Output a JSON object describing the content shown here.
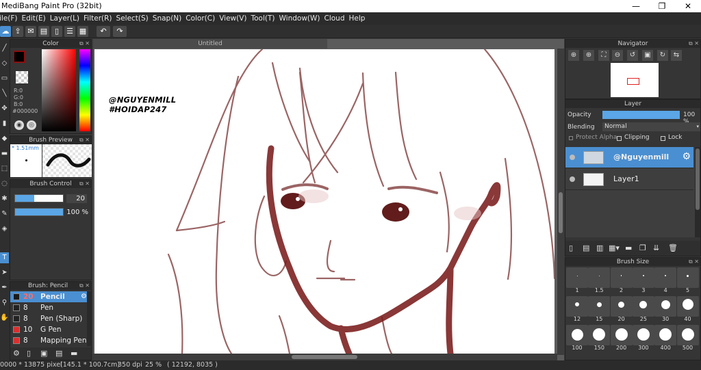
{
  "titlebar": {
    "title": "MediBang Paint Pro (32bit)",
    "minimize": "—",
    "maximize": "❐",
    "close": "✕"
  },
  "menu": [
    "ile(F)",
    "Edit(E)",
    "Layer(L)",
    "Filter(R)",
    "Select(S)",
    "Snap(N)",
    "Color(C)",
    "View(V)",
    "Tool(T)",
    "Window(W)",
    "Cloud",
    "Help"
  ],
  "document": {
    "tab": "Untitled",
    "watermark_line1": "@NGUYENMILL",
    "watermark_line2": "#HOIDAP247"
  },
  "color_panel": {
    "title": "Color",
    "r": "R:0",
    "g": "G:0",
    "b": "B:0",
    "hex": "#000000",
    "foreground": "#8b0f0f"
  },
  "brush_preview": {
    "title": "Brush Preview",
    "size": "* 1.51mm"
  },
  "brush_control": {
    "title": "Brush Control",
    "size_value": "20",
    "opacity_value": "100 %"
  },
  "brush_list": {
    "title": "Brush: Pencil",
    "items": [
      {
        "size": "20",
        "name": "Pencil",
        "color": "#1a1a1a",
        "selected": true
      },
      {
        "size": "8",
        "name": "Pen",
        "color": "#222222",
        "selected": false
      },
      {
        "size": "8",
        "name": "Pen (Sharp)",
        "color": "#222222",
        "selected": false
      },
      {
        "size": "10",
        "name": "G Pen",
        "color": "#d93030",
        "selected": false
      },
      {
        "size": "8",
        "name": "Mapping Pen",
        "color": "#d93030",
        "selected": false
      }
    ]
  },
  "navigator": {
    "title": "Navigator"
  },
  "layer_panel": {
    "title": "Layer",
    "opacity_label": "Opacity",
    "opacity_value": "100 %",
    "opacity_fraction": 1.0,
    "blending_label": "Blending",
    "blending_value": "Normal",
    "protect_alpha": "Protect Alpha",
    "clipping": "Clipping",
    "lock": "Lock",
    "layers": [
      {
        "name": "@Nguyenmill",
        "selected": true
      },
      {
        "name": "Layer1",
        "selected": false
      }
    ]
  },
  "brush_size": {
    "title": "Brush Size",
    "rows": [
      [
        "1",
        "1.5",
        "2",
        "3",
        "4",
        "5"
      ],
      [
        "12",
        "15",
        "20",
        "25",
        "30",
        "40"
      ],
      [
        "100",
        "150",
        "200",
        "300",
        "400",
        "500"
      ]
    ]
  },
  "status": {
    "dimensions": "0000 * 13875 pixel",
    "size_cm": "(145.1 * 100.7cm)",
    "dpi": "350 dpi",
    "zoom": "25 %",
    "coords": "( 12192, 8035 )"
  },
  "colors": {
    "accent": "#4a8fd1",
    "panel": "#353535",
    "stroke": "#7a1c1c"
  }
}
